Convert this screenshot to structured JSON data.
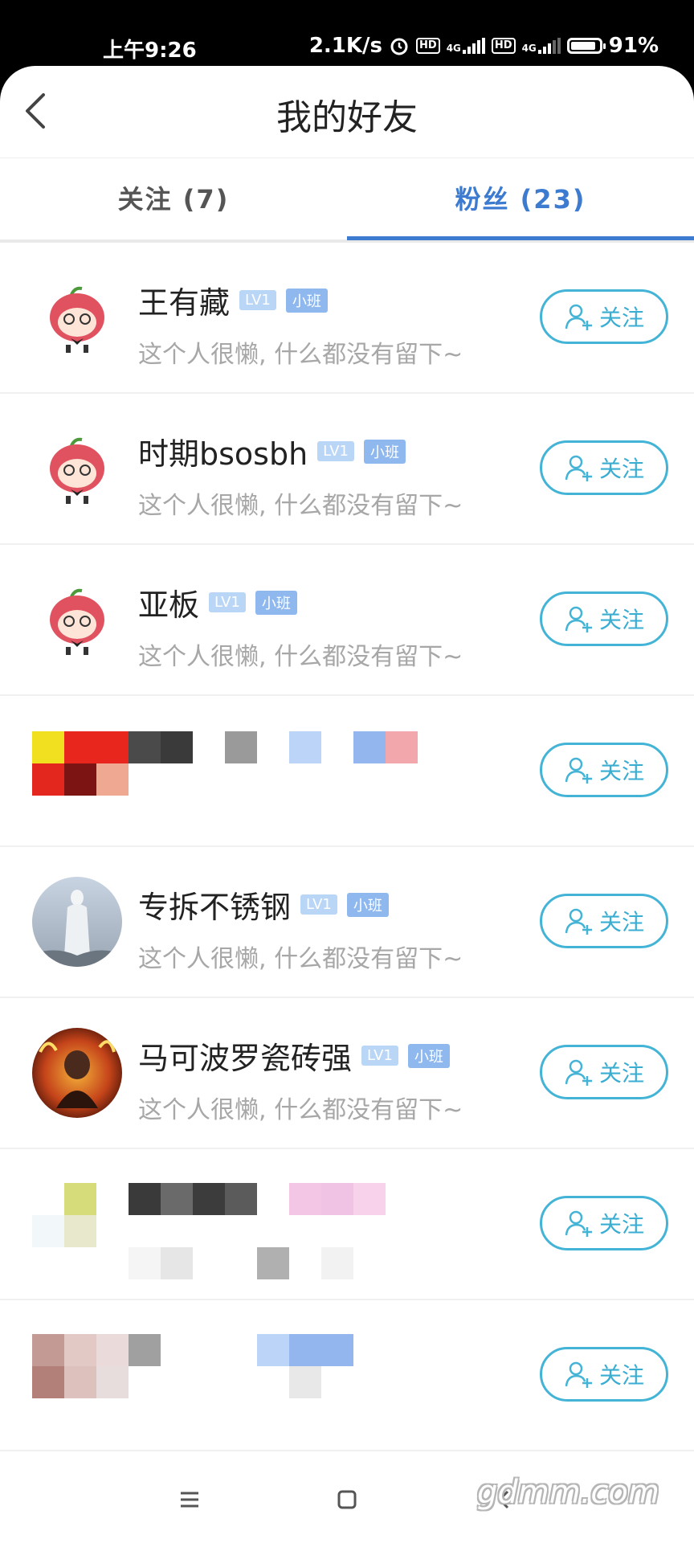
{
  "status_bar": {
    "time": "上午9:26",
    "net_speed": "2.1K/s",
    "hd1": "HD",
    "hd2": "HD",
    "net1": "4G",
    "net2": "4G",
    "battery": "91%"
  },
  "header": {
    "title": "我的好友",
    "back_icon": "chevron-left-icon"
  },
  "tabs": [
    {
      "label": "关注 (7)",
      "active": false
    },
    {
      "label": "粉丝 (23)",
      "active": true
    }
  ],
  "colors": {
    "accent": "#3d7bd0",
    "follow": "#44b4d6",
    "badge_lv": "#b9d6f7",
    "badge_class": "#8fb8ef",
    "bio_text": "#a7a7a7"
  },
  "follow_label": "关注",
  "list": [
    {
      "name": "王有藏",
      "level": "LV1",
      "class_badge": "小班",
      "bio": "这个人很懒, 什么都没有留下~",
      "avatar": "lychee-mascot"
    },
    {
      "name": "时期bsosbh",
      "level": "LV1",
      "class_badge": "小班",
      "bio": "这个人很懒, 什么都没有留下~",
      "avatar": "lychee-mascot"
    },
    {
      "name": "亚板",
      "level": "LV1",
      "class_badge": "小班",
      "bio": "这个人很懒, 什么都没有留下~",
      "avatar": "lychee-mascot"
    },
    {
      "pixelated": true
    },
    {
      "name": "专拆不锈钢",
      "level": "LV1",
      "class_badge": "小班",
      "bio": "这个人很懒, 什么都没有留下~",
      "avatar": "statue-photo"
    },
    {
      "name": "马可波罗瓷砖强",
      "level": "LV1",
      "class_badge": "小班",
      "bio": "这个人很懒, 什么都没有留下~",
      "avatar": "fire-portrait"
    },
    {
      "pixelated": true
    },
    {
      "pixelated": true
    }
  ],
  "watermark": "gdmm.com"
}
